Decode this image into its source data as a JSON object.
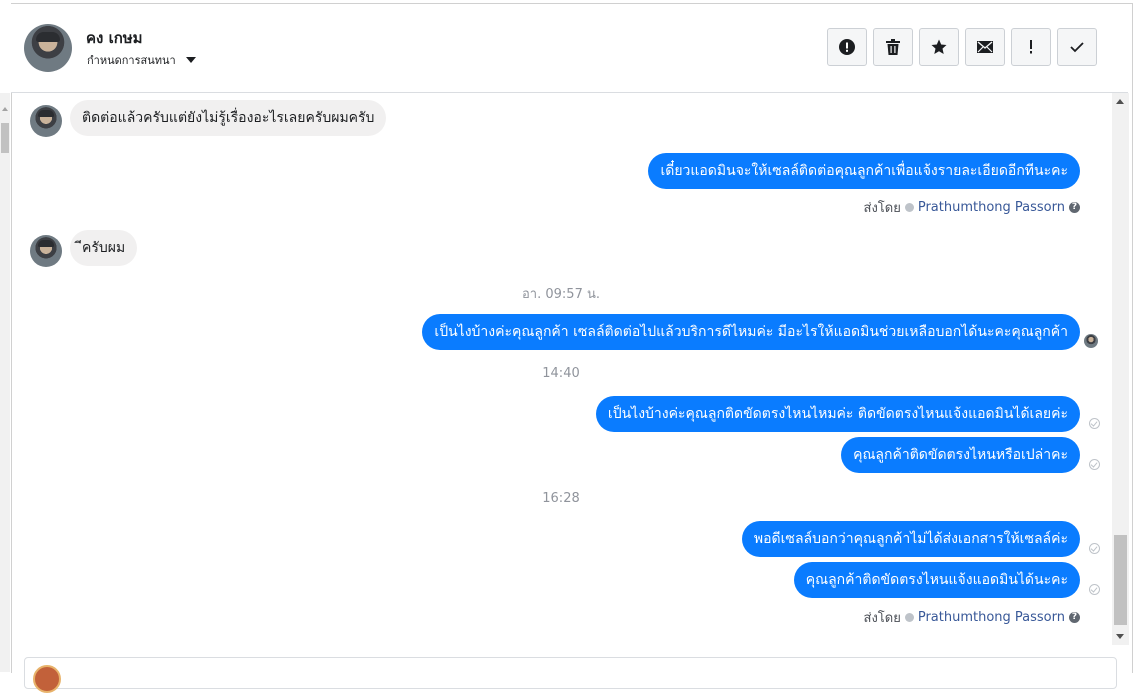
{
  "header": {
    "contact_name": "คง เกษม",
    "sub_label": "กำหนดการสนทนา",
    "tools": [
      {
        "icon": "alert-circle-icon",
        "glyph": "!"
      },
      {
        "icon": "trash-icon",
        "glyph": "🗑"
      },
      {
        "icon": "star-icon",
        "glyph": "★"
      },
      {
        "icon": "mail-icon",
        "glyph": "✉"
      },
      {
        "icon": "exclamation-icon",
        "glyph": "!"
      },
      {
        "icon": "check-icon",
        "glyph": "✓"
      }
    ]
  },
  "messages": {
    "m1": "ติดต่อแล้วครับแต่ยังไม่รู้เรื่องอะไรเลยครับผมครับ",
    "m2": "เดี๋ยวแอดมินจะให้เซลล์ติดต่อคุณลูกค้าเพื่อแจ้งรายละเอียดอีกทีนะคะ",
    "sent_by_label": "ส่งโดย",
    "sent_by_name": "Prathumthong Passorn",
    "m3": "ีครับผม",
    "time1": "อา. 09:57 น.",
    "m4": "เป็นไงบ้างค่ะคุณลูกค้า เซลล์ติดต่อไปแล้วบริการดีไหมค่ะ มีอะไรให้แอดมินช่วยเหลือบอกได้นะคะคุณลูกค้า",
    "time2": "14:40",
    "m5": "เป็นไงบ้างค่ะคุณลูกติดขัดตรงไหนไหมค่ะ ติดขัดตรงไหนแจ้งแอดมินได้เลยค่ะ",
    "m6": "คุณลูกค้าติดขัดตรงไหนหรือเปล่าคะ",
    "time3": "16:28",
    "m7": "พอดีเซลล์บอกว่าคุณลูกค้าไม่ได้ส่งเอกสารให้เซลล์ค่ะ",
    "m8": "คุณลูกค้าติดขัดตรงไหนแจ้งแอดมินได้นะคะ"
  },
  "colors": {
    "outgoing_bubble": "#0a7cff",
    "incoming_bubble": "#f1f0f0",
    "sender_name": "#385898"
  }
}
